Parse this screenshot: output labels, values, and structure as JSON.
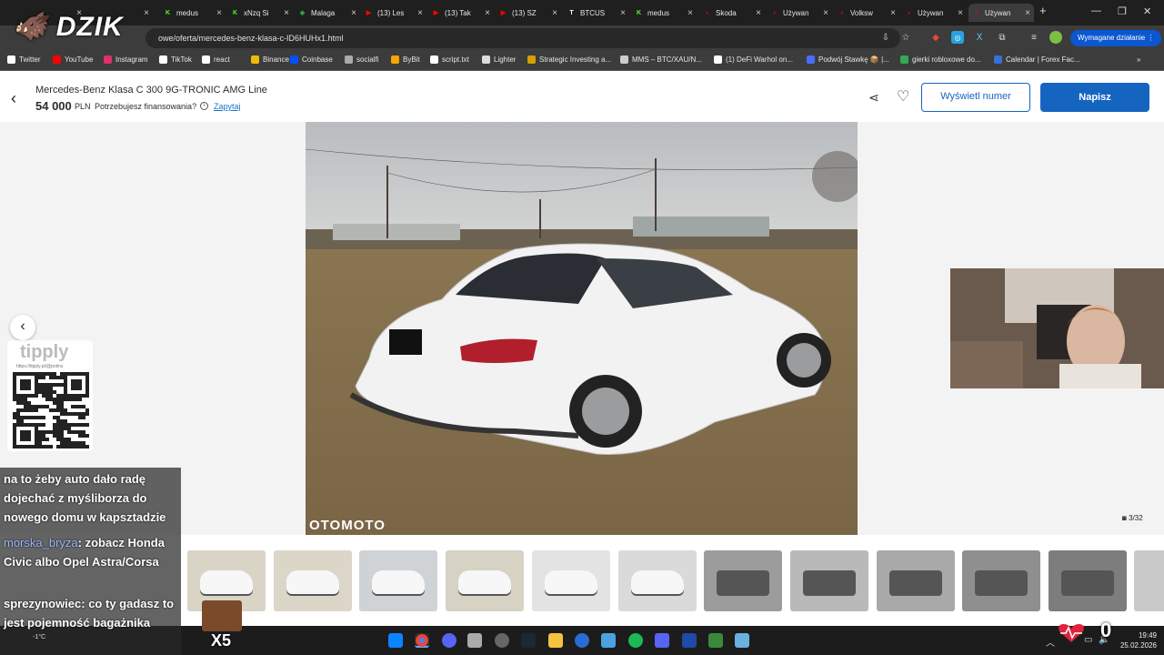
{
  "browser": {
    "tabs": [
      {
        "label": "",
        "icon": "twitch",
        "color": "#9146ff",
        "active": false
      },
      {
        "label": "",
        "icon": "twitch",
        "color": "#9146ff",
        "active": false
      },
      {
        "label": "medus",
        "icon": "kick",
        "color": "#53fc18",
        "active": false
      },
      {
        "label": "xNzq Si",
        "icon": "kick",
        "color": "#53fc18",
        "active": false
      },
      {
        "label": "Malaga",
        "icon": "maps",
        "color": "#34a853",
        "active": false
      },
      {
        "label": "(13) Les",
        "icon": "youtube",
        "color": "#ff0000",
        "active": false
      },
      {
        "label": "(13) Tak",
        "icon": "youtube",
        "color": "#ff0000",
        "active": false
      },
      {
        "label": "(13) SZ",
        "icon": "youtube",
        "color": "#ff0000",
        "active": false
      },
      {
        "label": "BTCUS",
        "icon": "tradingview",
        "color": "#ffffff",
        "active": false
      },
      {
        "label": "medus",
        "icon": "kick",
        "color": "#53fc18",
        "active": false
      },
      {
        "label": "Skoda",
        "icon": "otomoto",
        "color": "#e4002b",
        "active": false
      },
      {
        "label": "Używan",
        "icon": "otomoto",
        "color": "#e4002b",
        "active": false
      },
      {
        "label": "Volksw",
        "icon": "otomoto",
        "color": "#e4002b",
        "active": false
      },
      {
        "label": "Używan",
        "icon": "otomoto",
        "color": "#e4002b",
        "active": false
      },
      {
        "label": "Używan",
        "icon": "otomoto",
        "color": "#e4002b",
        "active": true
      }
    ],
    "url": "owe/oferta/mercedes-benz-klasa-c-ID6HUHx1.html",
    "required_action": "Wymagane działanie",
    "bookmarks": [
      {
        "label": "Twitter",
        "color": "#ffffff"
      },
      {
        "label": "YouTube",
        "color": "#ff0000"
      },
      {
        "label": "Instagram",
        "color": "#e1306c"
      },
      {
        "label": "TikTok",
        "color": "#ffffff"
      },
      {
        "label": "react",
        "color": "#ffffff"
      },
      {
        "label": "Binance",
        "color": "#f0b90b"
      },
      {
        "label": "Coinbase",
        "color": "#0052ff"
      },
      {
        "label": "socialfi",
        "color": "#aaaaaa"
      },
      {
        "label": "ByBit",
        "color": "#f7a600"
      },
      {
        "label": "script.txt",
        "color": "#ffffff"
      },
      {
        "label": "Lighter",
        "color": "#dddddd"
      },
      {
        "label": "Strategic Investing a...",
        "color": "#d4a000"
      },
      {
        "label": "MMS – BTC/XAU/N...",
        "color": "#cccccc"
      },
      {
        "label": "(1) DeFi Warhol on...",
        "color": "#ffffff"
      },
      {
        "label": "Podwój Stawkę 📦 |...",
        "color": "#4a6cf7"
      },
      {
        "label": "gierki robloxowe do...",
        "color": "#34a853"
      },
      {
        "label": "Calendar | Forex Fac...",
        "color": "#3a6fd8"
      }
    ]
  },
  "listing": {
    "title": "Mercedes-Benz Klasa C 300 9G-TRONIC AMG Line",
    "price": "54 000",
    "currency": "PLN",
    "financing_question": "Potrzebujesz finansowania?",
    "ask_link": "Zapytaj",
    "show_number": "Wyświetl numer",
    "write": "Napisz",
    "photo_watermark": "OTOMOTO",
    "photo_counter": "3/32",
    "thumbnail_count": 11
  },
  "overlay": {
    "logo": "DZIK",
    "tipply_brand": "tipply",
    "tipply_url": "https://tipply.pl/@potins",
    "chat": [
      {
        "user": "",
        "text": "na to żeby auto dało radę dojechać z myśliborza do nowego domu w kapsztadzie"
      },
      {
        "user": "morska_bryza",
        "text": ": zobacz Honda Civic albo Opel Astra/Corsa"
      },
      {
        "user": "sprezynowiec",
        "text": ": co ty gadasz to jest pojemność bagażnika"
      }
    ],
    "multiplier": "X5"
  },
  "taskbar": {
    "time": "19:49",
    "date": "25.02.2026",
    "weather": "-1°C",
    "badge": "0"
  }
}
